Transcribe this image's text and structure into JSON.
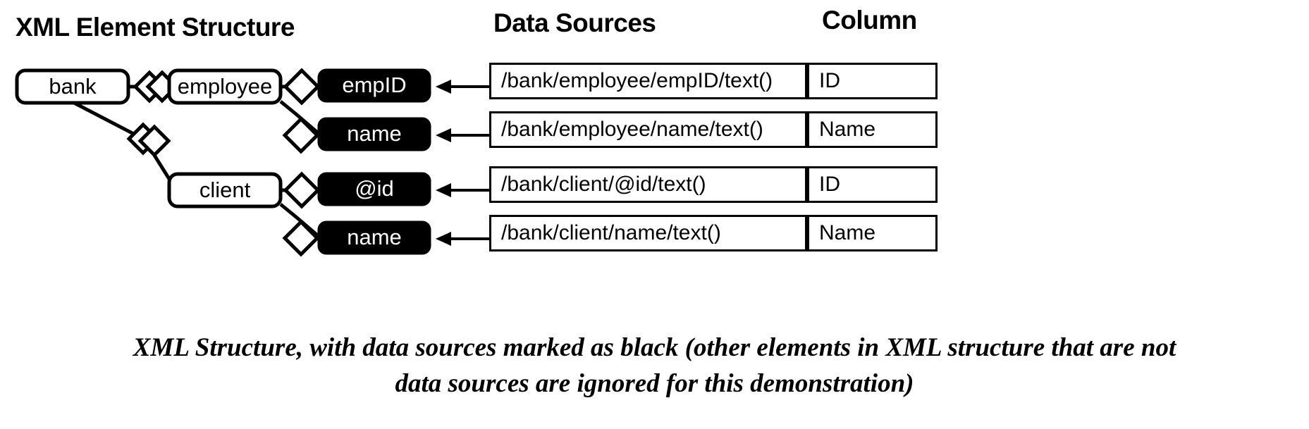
{
  "headers": {
    "structure": "XML Element Structure",
    "sources": "Data Sources",
    "column": "Column"
  },
  "tree": {
    "root": {
      "label": "bank",
      "type": "element"
    },
    "elements": [
      {
        "label": "employee",
        "type": "element"
      },
      {
        "label": "client",
        "type": "element"
      }
    ],
    "data_sources": [
      {
        "label": "empID",
        "type": "data-source",
        "parent": "employee"
      },
      {
        "label": "name",
        "type": "data-source",
        "parent": "employee"
      },
      {
        "label": "@id",
        "type": "data-source",
        "parent": "client"
      },
      {
        "label": "name",
        "type": "data-source",
        "parent": "client"
      }
    ]
  },
  "table": {
    "rows": [
      {
        "path": "/bank/employee/empID/text()",
        "column": "ID"
      },
      {
        "path": "/bank/employee/name/text()",
        "column": "Name"
      },
      {
        "path": "/bank/client/@id/text()",
        "column": "ID"
      },
      {
        "path": "/bank/client/name/text()",
        "column": "Name"
      }
    ]
  },
  "caption": {
    "line1": "XML Structure, with data sources marked as black (other elements in XML structure that are not",
    "line2": "data sources are ignored for this demonstration)"
  },
  "colors": {
    "data_source_fill": "#000000",
    "data_source_text": "#ffffff",
    "element_fill": "#ffffff",
    "stroke": "#000000",
    "background": "#ffffff"
  }
}
